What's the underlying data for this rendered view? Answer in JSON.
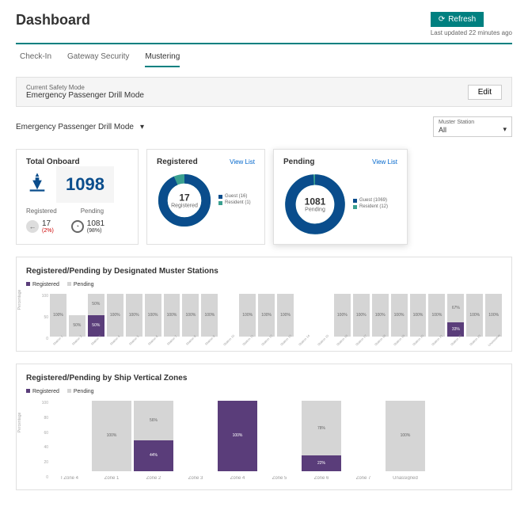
{
  "header": {
    "title": "Dashboard",
    "refresh": "Refresh",
    "last_updated": "Last updated 22 minutes ago"
  },
  "tabs": [
    "Check-In",
    "Gateway Security",
    "Mustering"
  ],
  "active_tab": 2,
  "mode_bar": {
    "label": "Current Safety Mode",
    "value": "Emergency Passenger Drill Mode",
    "edit": "Edit"
  },
  "filter": {
    "mode": "Emergency Passenger Drill Mode",
    "muster_label": "Muster Station",
    "muster_value": "All"
  },
  "onboard": {
    "title": "Total Onboard",
    "total": "1098",
    "labels": [
      "Registered",
      "Pending"
    ],
    "registered": {
      "num": "17",
      "pct": "(2%)"
    },
    "pending": {
      "num": "1081",
      "pct": "(98%)"
    }
  },
  "registered_card": {
    "title": "Registered",
    "view": "View List",
    "num": "17",
    "lbl": "Registered",
    "legend": [
      {
        "label": "Guest (16)",
        "color": "#0a4d8c"
      },
      {
        "label": "Resident (1)",
        "color": "#3aa090"
      }
    ]
  },
  "pending_card": {
    "title": "Pending",
    "view": "View List",
    "num": "1081",
    "lbl": "Pending",
    "legend": [
      {
        "label": "Guest (1069)",
        "color": "#0a4d8c"
      },
      {
        "label": "Resident (12)",
        "color": "#3aa090"
      }
    ]
  },
  "colors": {
    "registered": "#5a3d7a",
    "pending": "#d5d5d5"
  },
  "section1": {
    "title": "Registered/Pending by Designated Muster Stations",
    "legend": [
      "Registered",
      "Pending"
    ]
  },
  "section2": {
    "title": "Registered/Pending by Ship Vertical Zones",
    "legend": [
      "Registered",
      "Pending"
    ]
  },
  "chart_data": [
    {
      "type": "bar",
      "title": "Registered/Pending by Designated Muster Stations",
      "ylabel": "Percentage",
      "ylim": [
        0,
        100
      ],
      "series": [
        {
          "name": "Registered",
          "values": [
            0,
            0,
            50,
            0,
            0,
            0,
            0,
            0,
            0,
            0,
            0,
            0,
            0,
            0,
            0,
            0,
            0,
            0,
            0,
            0,
            0,
            33,
            0,
            0
          ]
        },
        {
          "name": "Pending",
          "values": [
            100,
            50,
            50,
            100,
            100,
            100,
            100,
            100,
            100,
            0,
            100,
            100,
            100,
            0,
            0,
            100,
            100,
            100,
            100,
            100,
            100,
            67,
            100,
            100
          ]
        }
      ],
      "categories": [
        "Station 1",
        "Station 2",
        "Station 3",
        "Station 4",
        "Station 5",
        "Station 6",
        "Station 7",
        "Station 8",
        "Station 9",
        "Station 10",
        "Station 11",
        "Station 12",
        "Station 13",
        "Station 14",
        "Station 15",
        "Station 16",
        "Station 17",
        "Station 18",
        "Station 19",
        "Station 20",
        "Station 21",
        "Station 22",
        "Station 23",
        "Unassigned"
      ]
    },
    {
      "type": "bar",
      "title": "Registered/Pending by Ship Vertical Zones",
      "ylabel": "Percentage",
      "ylim": [
        0,
        100
      ],
      "series": [
        {
          "name": "Registered",
          "values": [
            0,
            0,
            44,
            0,
            100,
            0,
            22,
            0,
            0
          ]
        },
        {
          "name": "Pending",
          "values": [
            0,
            100,
            56,
            0,
            0,
            0,
            78,
            0,
            100
          ]
        }
      ],
      "categories": [
        "I Zone 4",
        "Zone 1",
        "Zone 2",
        "Zone 3",
        "Zone 4",
        "Zone 5",
        "Zone 6",
        "Zone 7",
        "Unassigned"
      ]
    }
  ]
}
